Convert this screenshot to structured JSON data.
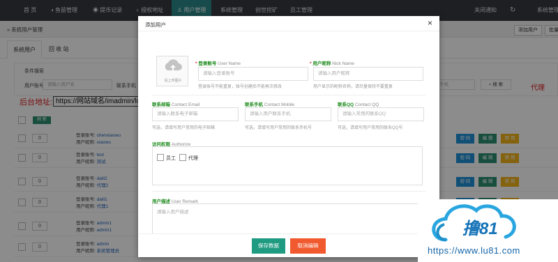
{
  "topnav": {
    "items": [
      "首 页",
      "鱼苗管理",
      "提币记录",
      "授权地址",
      "用户管理",
      "系统管理",
      "创世挖矿",
      "员工管理"
    ],
    "right": [
      "关闭通知",
      "系统管理"
    ]
  },
  "breadcrumb": "» 系统用户管理",
  "toolbar": {
    "add_user": "添加用户",
    "batch": "批量"
  },
  "tabs": [
    "系统用户",
    "回 收 站"
  ],
  "search": {
    "section_label": "条件搜索",
    "account_label": "用户账号",
    "account_placeholder": "请输入用户名",
    "phone_label": "联系手机",
    "right_field_text": "(手机",
    "search_button": "搜 索",
    "agent_text": "代理"
  },
  "backend": {
    "label": "后台地址:",
    "url": "https://网站域名/imadmin/login."
  },
  "refresh": "刷 新",
  "rows": [
    {
      "sort": "0",
      "login_label": "登录账号:",
      "login": "chenxiaowu",
      "nick_label": "用户昵称:",
      "nick": "xiaowu"
    },
    {
      "sort": "0",
      "login_label": "登录账号:",
      "login": "test",
      "nick_label": "用户昵称:",
      "nick": "测试"
    },
    {
      "sort": "0",
      "login_label": "登录账号:",
      "login": "daili2",
      "nick_label": "用户昵称:",
      "nick": "代理2"
    },
    {
      "sort": "0",
      "login_label": "登录账号:",
      "login": "daili1",
      "nick_label": "用户昵称:",
      "nick": "代理1"
    },
    {
      "sort": "0",
      "login_label": "登录账号:",
      "login": "admin1",
      "nick_label": "用户昵称:",
      "nick": "admin1"
    },
    {
      "sort": "0",
      "login_label": "登录账号:",
      "login": "admin",
      "nick_label": "用户昵称:",
      "nick": "系统管理员"
    }
  ],
  "row_actions": {
    "password": "密 码",
    "edit": "编 辑",
    "disable": "禁 用"
  },
  "modal": {
    "title": "添加用户",
    "upload_label": "请上传图片",
    "login": {
      "label": "登录账号",
      "en": "User Name",
      "placeholder": "请输入登录账号",
      "hint": "登录账号不能重复，账号创建后不能再次修改"
    },
    "nick": {
      "label": "用户昵称",
      "en": "Nick Name",
      "placeholder": "请输入用户昵称",
      "hint": "用户显示的昵称名称，请尽量保持不要重复"
    },
    "email": {
      "label": "联系邮箱",
      "en": "Contact Email",
      "placeholder": "请输入联系电子邮箱",
      "hint": "可选，请填写用户常用的电子邮箱"
    },
    "mobile": {
      "label": "联系手机",
      "en": "Contact Mobile",
      "placeholder": "请输入用户联系手机",
      "hint": "可选，请填写用户常用的联系手机号"
    },
    "qq": {
      "label": "联系QQ",
      "en": "Contact QQ",
      "placeholder": "请输入常用的联系QQ",
      "hint": "可选，请填写用户常用的联系QQ号"
    },
    "authorize": {
      "label": "访问权限",
      "en": "Authorize",
      "options": [
        "员工",
        "代理"
      ]
    },
    "remark": {
      "label": "用户描述",
      "en": "User Remark",
      "placeholder": "请输入用户描述"
    },
    "save": "保存数据",
    "cancel": "取消编辑"
  },
  "watermark": {
    "logo_text": "撸81",
    "url": "https://www.lu81.com"
  },
  "colors": {
    "nav_bg": "#353a40",
    "nav_active": "#2d8a8a",
    "save": "#1f9b82",
    "cancel": "#f05a2e",
    "btn_blue": "#1e90d8",
    "btn_green": "#2a8f6f",
    "btn_yellow": "#f0b21a",
    "alert_red": "#e02020"
  }
}
